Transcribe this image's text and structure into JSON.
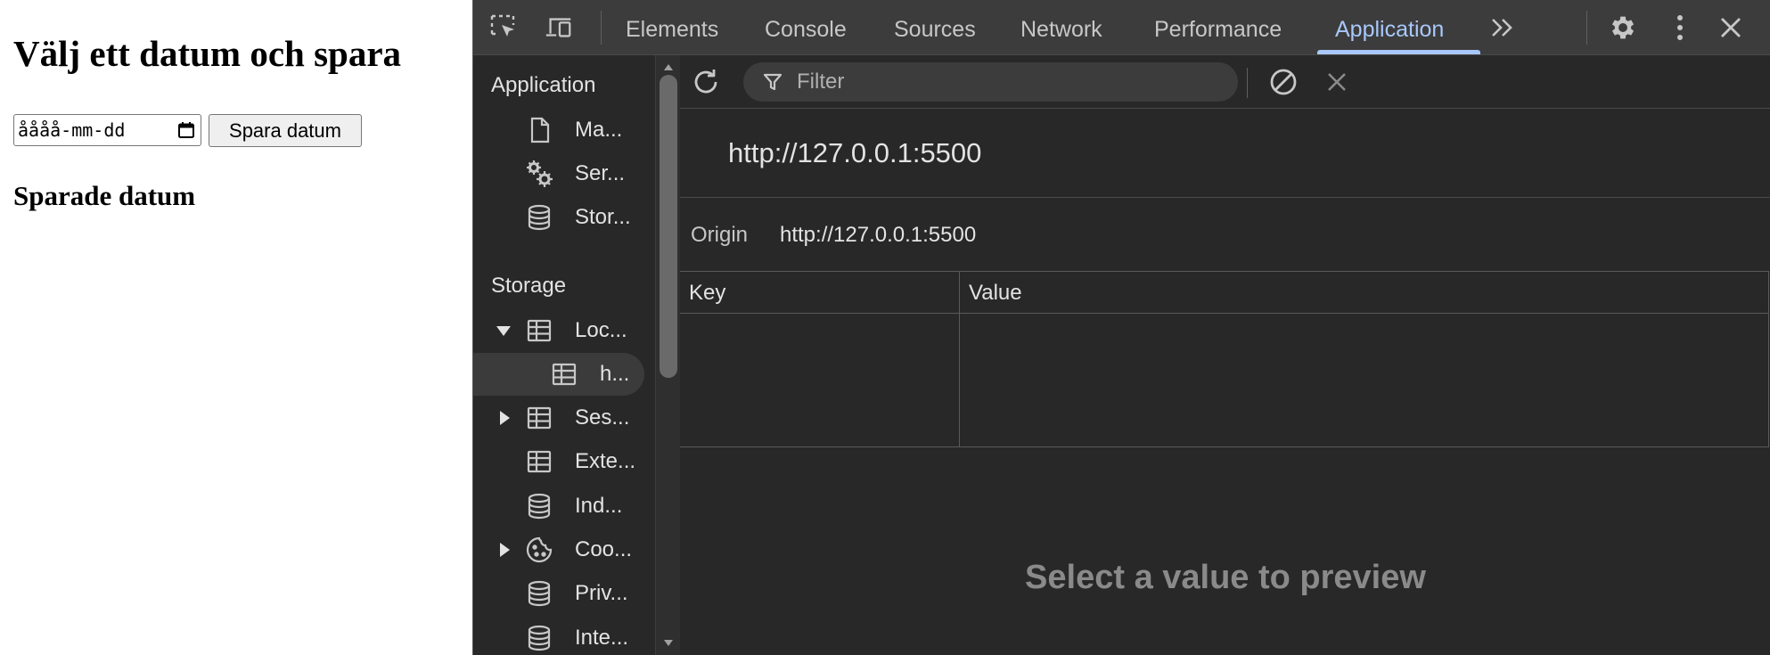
{
  "page": {
    "heading": "Välj ett datum och spara",
    "date_input": {
      "placeholder": "åååå-mm-dd"
    },
    "save_button": "Spara datum",
    "saved_heading": "Sparade datum"
  },
  "devtools": {
    "tabs": [
      {
        "label": "Elements"
      },
      {
        "label": "Console"
      },
      {
        "label": "Sources"
      },
      {
        "label": "Network"
      },
      {
        "label": "Performance"
      },
      {
        "label": "Application",
        "active": true
      }
    ],
    "more_tabs_glyph": "»",
    "accent_color": "#a8c7fa",
    "sidebar": {
      "sections": [
        {
          "title": "Application",
          "items": [
            {
              "label": "Ma...",
              "icon": "document-icon"
            },
            {
              "label": "Ser...",
              "icon": "gears-icon"
            },
            {
              "label": "Stor...",
              "icon": "database-icon"
            }
          ]
        },
        {
          "title": "Storage",
          "items": [
            {
              "label": "Loc...",
              "icon": "table-icon",
              "expanded": true
            },
            {
              "label": "h...",
              "icon": "table-icon",
              "selected": true
            },
            {
              "label": "Ses...",
              "icon": "table-icon",
              "collapsed": true
            },
            {
              "label": "Exte...",
              "icon": "table-icon"
            },
            {
              "label": "Ind...",
              "icon": "database-icon"
            },
            {
              "label": "Coo...",
              "icon": "cookie-icon",
              "collapsed": true
            },
            {
              "label": "Priv...",
              "icon": "database-icon"
            },
            {
              "label": "Inte...",
              "icon": "database-icon"
            }
          ]
        }
      ]
    },
    "toolbar": {
      "filter_placeholder": "Filter"
    },
    "origin_title": "http://127.0.0.1:5500",
    "origin_label": "Origin",
    "origin_value": "http://127.0.0.1:5500",
    "table": {
      "columns": [
        "Key",
        "Value"
      ],
      "rows": []
    },
    "preview_text": "Select a value to preview"
  }
}
